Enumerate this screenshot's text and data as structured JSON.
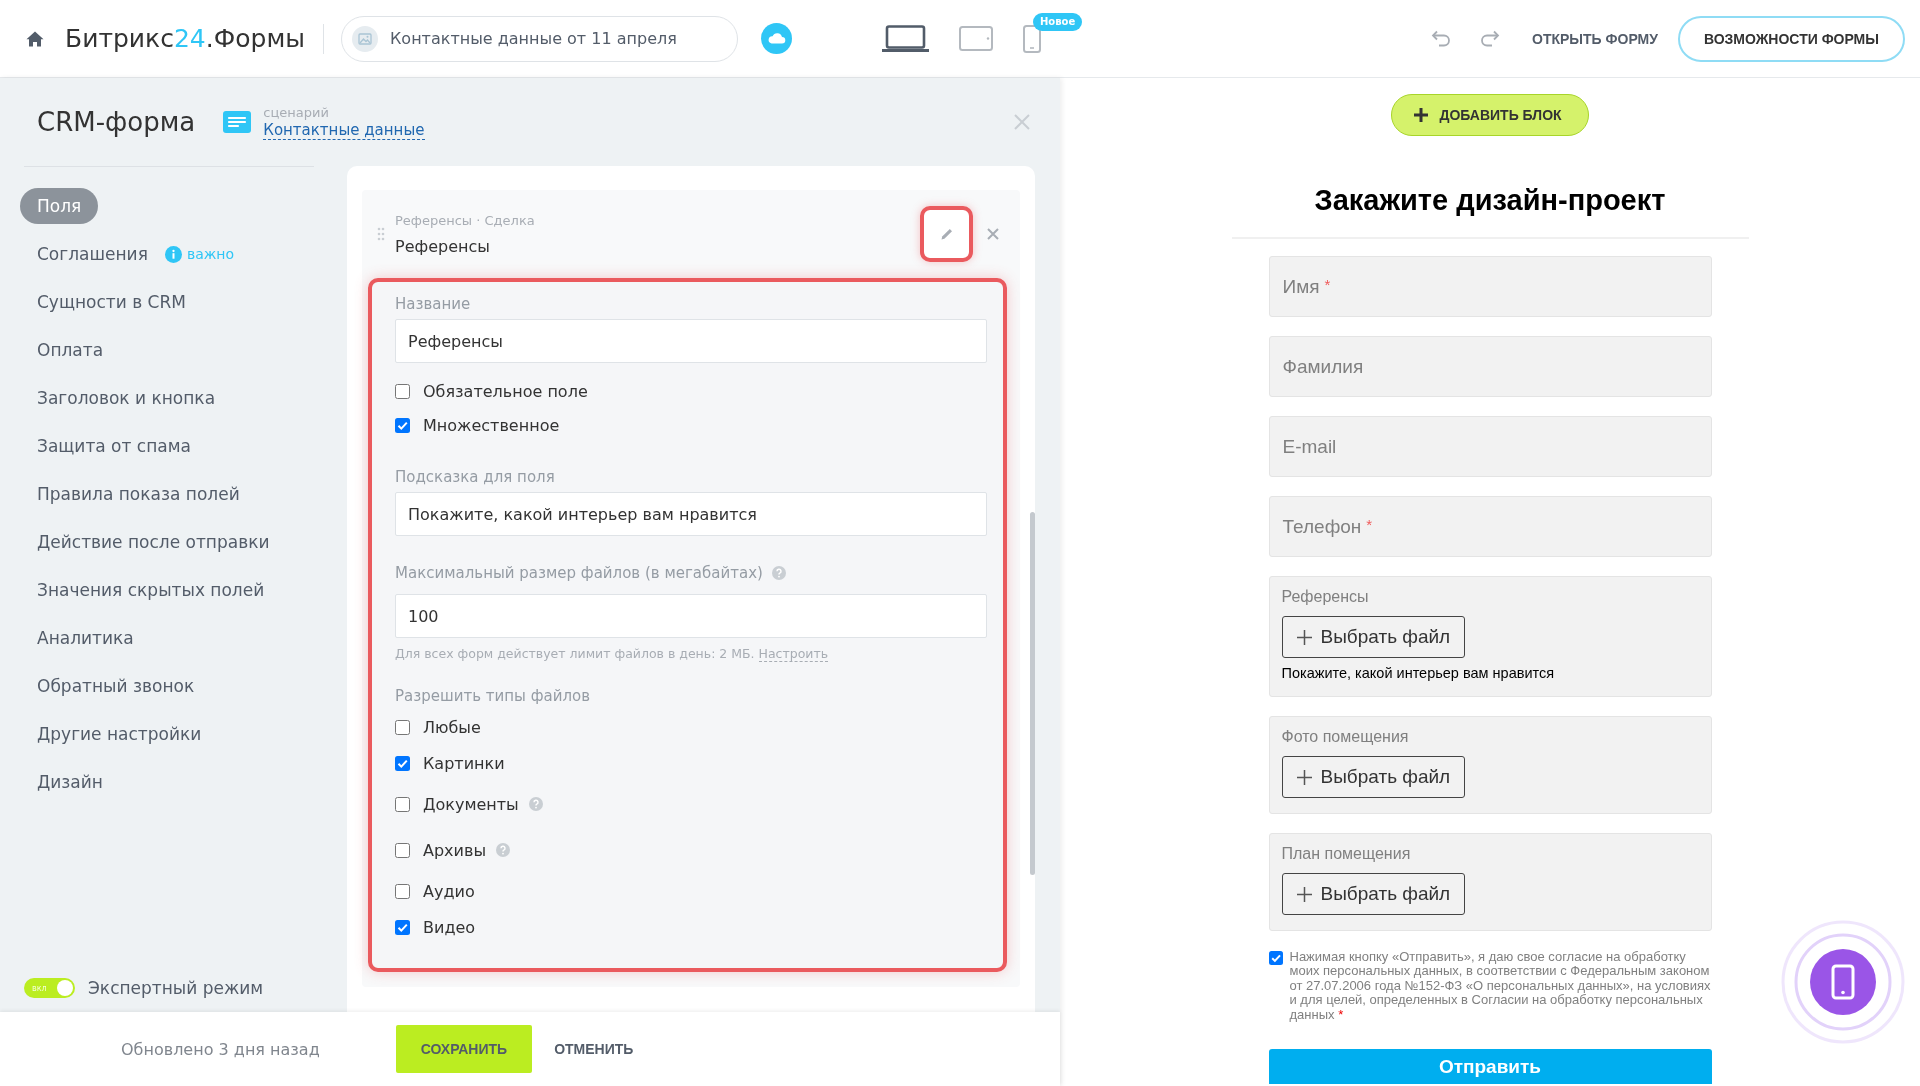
{
  "header": {
    "logo": {
      "brand": "Битрикс",
      "number": "24",
      "product": ".Формы"
    },
    "form_name": "Контактные данные от 11 апреля",
    "devices": [
      {
        "kind": "laptop",
        "selected": true
      },
      {
        "kind": "tablet",
        "selected": false
      },
      {
        "kind": "phone",
        "selected": false,
        "badge": "Новое"
      }
    ],
    "open_form": "ОТКРЫТЬ ФОРМУ",
    "features": "ВОЗМОЖНОСТИ ФОРМЫ"
  },
  "editor": {
    "title": "CRM-форма",
    "scenario": {
      "caption": "сценарий",
      "link": "Контактные данные"
    },
    "nav": [
      {
        "label": "Поля",
        "selected": true
      },
      {
        "label": "Соглашения",
        "selected": false,
        "note": "важно"
      },
      {
        "label": "Сущности в CRM",
        "selected": false
      },
      {
        "label": "Оплата",
        "selected": false
      },
      {
        "label": "Заголовок и кнопка",
        "selected": false
      },
      {
        "label": "Защита от спама",
        "selected": false
      },
      {
        "label": "Правила показа полей",
        "selected": false
      },
      {
        "label": "Действие после отправки",
        "selected": false
      },
      {
        "label": "Значения скрытых полей",
        "selected": false
      },
      {
        "label": "Аналитика",
        "selected": false
      },
      {
        "label": "Обратный звонок",
        "selected": false
      },
      {
        "label": "Другие настройки",
        "selected": false
      },
      {
        "label": "Дизайн",
        "selected": false
      }
    ],
    "expert_mode": {
      "switch_text": "вкл",
      "on": true,
      "label": "Экспертный режим"
    },
    "field": {
      "caption": "Референсы · Сделка",
      "name": "Референсы",
      "settings": {
        "name": {
          "label": "Название",
          "value": "Референсы"
        },
        "flags": [
          {
            "label": "Обязательное поле",
            "checked": false
          },
          {
            "label": "Множественное",
            "checked": true
          }
        ],
        "hint": {
          "label": "Подсказка для поля",
          "value": "Покажите, какой интерьер вам нравится"
        },
        "max_size": {
          "label": "Максимальный размер файлов (в мегабайтах)",
          "help": true,
          "value": "100"
        },
        "limit_note": "Для всех форм действует лимит файлов в день: 2 МБ.",
        "limit_link": "Настроить",
        "types_label": "Разрешить типы файлов",
        "types": [
          {
            "label": "Любые",
            "checked": false,
            "help": false
          },
          {
            "label": "Картинки",
            "checked": true,
            "help": false
          },
          {
            "label": "Документы",
            "checked": false,
            "help": true
          },
          {
            "label": "Архивы",
            "checked": false,
            "help": true
          },
          {
            "label": "Аудио",
            "checked": false,
            "help": false
          },
          {
            "label": "Видео",
            "checked": true,
            "help": false
          }
        ]
      }
    },
    "footer": {
      "updated": "Обновлено 3 дня назад",
      "save": "СОХРАНИТЬ",
      "cancel": "ОТМЕНИТЬ"
    }
  },
  "preview": {
    "add_block": "ДОБАВИТЬ БЛОК",
    "title": "Закажите дизайн-проект",
    "fields": [
      {
        "kind": "text",
        "placeholder": "Имя",
        "required_mark": "*"
      },
      {
        "kind": "text",
        "placeholder": "Фамилия"
      },
      {
        "kind": "text",
        "placeholder": "E-mail"
      },
      {
        "kind": "text",
        "placeholder": "Телефон",
        "required_mark": "*"
      },
      {
        "kind": "file",
        "label": "Референсы",
        "button": "Выбрать файл",
        "hint": "Покажите, какой интерьер вам нравится"
      },
      {
        "kind": "file",
        "label": "Фото помещения",
        "button": "Выбрать файл"
      },
      {
        "kind": "file",
        "label": "План помещения",
        "button": "Выбрать файл"
      }
    ],
    "consent": {
      "checked": true,
      "text": "Нажимая кнопку «Отправить», я даю свое согласие на обработку моих персональных данных, в соответствии с Федеральным законом от 27.07.2006 года №152-ФЗ «О персональных данных», на условиях и для целей, определенных в Согласии на обработку персональных данных",
      "required_mark": "*"
    },
    "submit": "Отправить"
  }
}
